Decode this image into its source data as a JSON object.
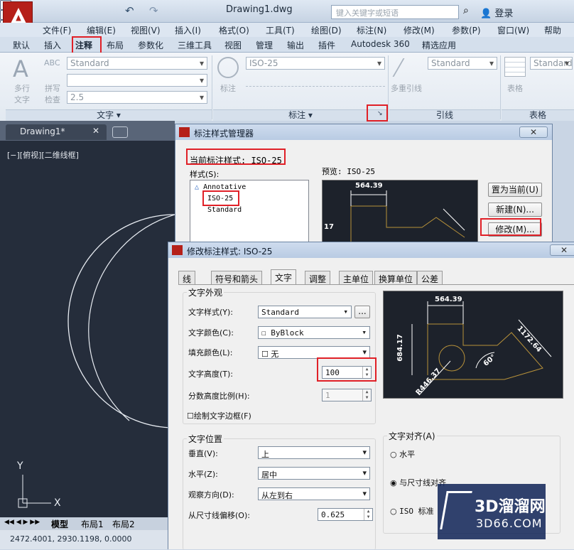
{
  "titlebar": {
    "doc_title": "Drawing1.dwg",
    "search_placeholder": "键入关键字或短语",
    "login": "登录"
  },
  "menus": [
    "文件(F)",
    "编辑(E)",
    "视图(V)",
    "插入(I)",
    "格式(O)",
    "工具(T)",
    "绘图(D)",
    "标注(N)",
    "修改(M)",
    "参数(P)",
    "窗口(W)",
    "帮助(H)"
  ],
  "ribbon_tabs": [
    "默认",
    "插入",
    "注释",
    "布局",
    "参数化",
    "三维工具",
    "视图",
    "管理",
    "输出",
    "插件",
    "Autodesk 360",
    "精选应用"
  ],
  "ribbon_active_tab": "注释",
  "ribbon": {
    "text_panel": {
      "title": "文字 ▾",
      "big_button": "多行\n文字",
      "spell": "拼写\n检查",
      "style": "Standard",
      "height": "2.5",
      "abc": "ABC",
      "big_A": "A"
    },
    "dim_panel": {
      "title": "标注 ▾",
      "style": "ISO-25",
      "button": "标注"
    },
    "leader_panel": {
      "title": "引线",
      "style": "Standard",
      "button": "多重引线"
    },
    "table_panel": {
      "title": "表格",
      "style": "Standard",
      "button": "表格"
    }
  },
  "doc_tab": "Drawing1*",
  "viewport_label": "[−][俯视][二维线框]",
  "layout_tabs": [
    "模型",
    "布局1",
    "布局2"
  ],
  "status_coords": "2472.4001, 2930.1198, 0.0000",
  "dim_manager": {
    "title": "标注样式管理器",
    "current_label": "当前标注样式: ISO-25",
    "styles_label": "样式(S):",
    "styles": [
      "Annotative",
      "ISO-25",
      "Standard"
    ],
    "preview_label": "预览: ISO-25",
    "buttons": [
      "置为当前(U)",
      "新建(N)...",
      "修改(M)..."
    ],
    "preview_value": "564.39",
    "preview_side_value": "17"
  },
  "modify_dialog": {
    "title": "修改标注样式: ISO-25",
    "tabs": [
      "线",
      "符号和箭头",
      "文字",
      "调整",
      "主单位",
      "换算单位",
      "公差"
    ],
    "active_tab": "文字",
    "appearance": {
      "heading": "文字外观",
      "text_style_label": "文字样式(Y):",
      "text_style": "Standard",
      "browse": "...",
      "text_color_label": "文字颜色(C):",
      "text_color": "ByBlock",
      "fill_color_label": "填充颜色(L):",
      "fill_color": "无",
      "text_height_label": "文字高度(T):",
      "text_height": "100",
      "fraction_label": "分数高度比例(H):",
      "fraction": "1",
      "frame_label": "绘制文字边框(F)"
    },
    "placement": {
      "heading": "文字位置",
      "vertical_label": "垂直(V):",
      "vertical": "上",
      "horizontal_label": "水平(Z):",
      "horizontal": "居中",
      "direction_label": "观察方向(D):",
      "direction": "从左到右",
      "offset_label": "从尺寸线偏移(O):",
      "offset": "0.625"
    },
    "alignment": {
      "heading": "文字对齐(A)",
      "options": [
        "水平",
        "与尺寸线对齐",
        "ISO 标准"
      ],
      "selected": "与尺寸线对齐"
    },
    "preview": {
      "top": "564.39",
      "left": "684.17",
      "right": "1172.64",
      "radius": "R446.37",
      "angle": "60°"
    }
  },
  "watermark": {
    "cn": "3D溜溜网",
    "url": "3D66.COM"
  },
  "colors": {
    "highlight": "#e02027",
    "canvas": "#252d3b",
    "acad_red": "#b52019"
  }
}
